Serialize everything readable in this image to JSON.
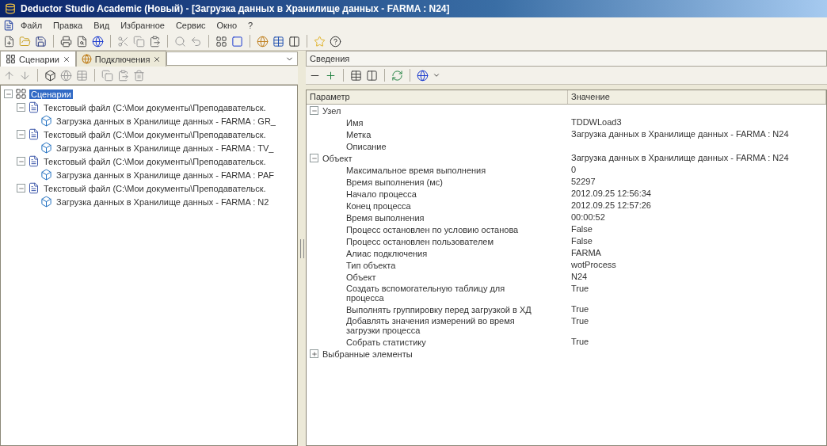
{
  "window": {
    "title": "Deductor Studio Academic (Новый) - [Загрузка данных в Хранилище данных - FARMA : N24]"
  },
  "menu": [
    "Файл",
    "Правка",
    "Вид",
    "Избранное",
    "Сервис",
    "Окно",
    "?"
  ],
  "left_tabs": [
    {
      "label": "Сценарии",
      "selected": true
    },
    {
      "label": "Подключения",
      "selected": false
    }
  ],
  "right_panel": {
    "title": "Сведения"
  },
  "tree": [
    {
      "label": "Сценарии",
      "kind": "root",
      "selected": true,
      "expanded": true,
      "children": [
        {
          "label": "Текстовый файл (C:\\Мои документы\\Преподавательск.",
          "kind": "file",
          "selected": false,
          "expanded": true,
          "children": [
            {
              "label": "Загрузка данных в Хранилище данных - FARMA : GR_",
              "kind": "load",
              "selected": false
            }
          ]
        },
        {
          "label": "Текстовый файл (C:\\Мои документы\\Преподавательск.",
          "kind": "file",
          "selected": false,
          "expanded": true,
          "children": [
            {
              "label": "Загрузка данных в Хранилище данных - FARMA : TV_",
              "kind": "load",
              "selected": false
            }
          ]
        },
        {
          "label": "Текстовый файл (C:\\Мои документы\\Преподавательск.",
          "kind": "file",
          "selected": false,
          "expanded": true,
          "children": [
            {
              "label": "Загрузка данных в Хранилище данных - FARMA : PAF",
              "kind": "load",
              "selected": false
            }
          ]
        },
        {
          "label": "Текстовый файл (C:\\Мои документы\\Преподавательск.",
          "kind": "file",
          "selected": false,
          "expanded": true,
          "children": [
            {
              "label": "Загрузка данных в Хранилище данных - FARMA : N2",
              "kind": "load",
              "selected": false
            }
          ]
        }
      ]
    }
  ],
  "properties": {
    "columns": [
      "Параметр",
      "Значение"
    ],
    "groups": [
      {
        "name": "Узел",
        "expanded": true,
        "rows": [
          {
            "param": "Имя",
            "value": "TDDWLoad3"
          },
          {
            "param": "Метка",
            "value": "Загрузка данных в Хранилище данных - FARMA : N24"
          },
          {
            "param": "Описание"
          }
        ]
      },
      {
        "name": "Объект",
        "value": "Загрузка данных в Хранилище данных - FARMA : N24",
        "expanded": true,
        "rows": [
          {
            "param": "Максимальное время выполнения",
            "value": "0"
          },
          {
            "param": "Время выполнения (мс)",
            "value": "52297"
          },
          {
            "param": "Начало процесса",
            "value": "2012.09.25 12:56:34"
          },
          {
            "param": "Конец процесса",
            "value": "2012.09.25 12:57:26"
          },
          {
            "param": "Время выполнения",
            "value": "00:00:52"
          },
          {
            "param": "Процесс остановлен по условию останова",
            "value": "False"
          },
          {
            "param": "Процесс остановлен пользователем",
            "value": "False"
          },
          {
            "param": "Алиас подключения",
            "value": "FARMA"
          },
          {
            "param": "Тип объекта",
            "value": "wotProcess"
          },
          {
            "param": "Объект",
            "value": "N24"
          },
          {
            "param": "Создать вспомогательную таблицу для процесса",
            "value": "True"
          },
          {
            "param": "Выполнять группировку перед загрузкой в ХД",
            "value": "True"
          },
          {
            "param": "Добавлять значения измерений во время загрузки процесса",
            "value": "True"
          },
          {
            "param": "Собрать статистику",
            "value": "True"
          }
        ]
      },
      {
        "name": "Выбранные элементы",
        "expanded": false
      }
    ]
  }
}
